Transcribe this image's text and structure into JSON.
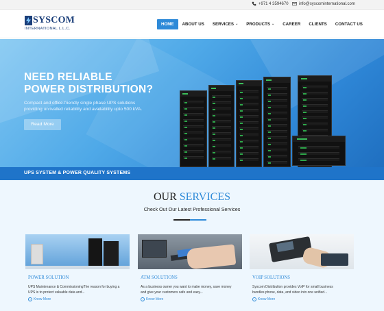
{
  "topbar": {
    "phone": "+971 4 3594670",
    "email": "info@syscominternational.com"
  },
  "logo": {
    "name": "SYSCOM",
    "subtitle": "INTERNATIONAL L.L.C."
  },
  "nav": {
    "items": [
      {
        "label": "HOME",
        "active": true
      },
      {
        "label": "ABOUT US"
      },
      {
        "label": "SERVICES",
        "dropdown": true
      },
      {
        "label": "PRODUCTS",
        "dropdown": true
      },
      {
        "label": "CAREER"
      },
      {
        "label": "CLIENTS"
      },
      {
        "label": "CONTACT US"
      }
    ]
  },
  "hero": {
    "title_line1": "NEED RELIABLE",
    "title_line2": "POWER DISTRIBUTION?",
    "desc_line1": "Compact and office-friendly single phase UPS solutions",
    "desc_line2": "providing unrivalled reliability and availability upto 500 kVA.",
    "button": "Read More"
  },
  "strip": {
    "label": "UPS SYSTEM & POWER QUALITY SYSTEMS"
  },
  "services": {
    "heading_a": "OUR",
    "heading_b": "SERVICES",
    "subheading": "Check Out Our Latest Professional Services",
    "cards": [
      {
        "title": "POWER SOLUTION",
        "text_line1": "UPS Maintenance & CommissioningThe reason for buying a",
        "text_line2": "UPS is to protect valuable data and...",
        "link": "Know More"
      },
      {
        "title": "ATM SOLUTIONS",
        "text_line1": "As a business owner you want to make money, save money",
        "text_line2": "and give your customers safe and easy...",
        "link": "Know More"
      },
      {
        "title": "VOIP SOLUTIONS",
        "text_line1": "Syscom Distribution provides VoIP for small business",
        "text_line2": "bundles phone, data, and video into one unified...",
        "link": "Know More"
      }
    ]
  },
  "colors": {
    "accent": "#2e8ad8",
    "brand": "#1b3f7a",
    "strip": "#1f74c9"
  }
}
